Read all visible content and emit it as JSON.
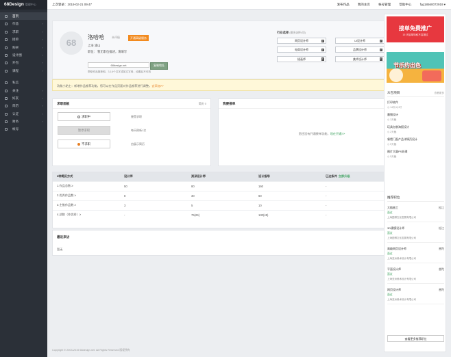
{
  "app": {
    "logo": "68Design",
    "logo_sub": "管理中心"
  },
  "sidebar": {
    "items": [
      {
        "label": "首页"
      },
      {
        "label": "作品"
      },
      {
        "label": "求职"
      },
      {
        "label": "接单"
      },
      {
        "label": "购买"
      },
      {
        "label": "设计圈"
      },
      {
        "label": "外包"
      },
      {
        "label": "课程"
      },
      {
        "label": "私信"
      },
      {
        "label": "关注"
      },
      {
        "label": "好友"
      },
      {
        "label": "简历"
      },
      {
        "label": "认证"
      },
      {
        "label": "财务"
      },
      {
        "label": "帐号"
      }
    ]
  },
  "topbar": {
    "last_login": "上次登录：2019-02-21 09:47",
    "links": [
      "发布作品",
      "我的主页",
      "帐号管理",
      "帮助中心",
      "fqq18560072919 ▾"
    ]
  },
  "profile": {
    "avatar_text": "68",
    "name": "洛哈哈",
    "badge_gray": "未评级",
    "badge_orange": "开通高级服务",
    "location": "上海 浦山",
    "desc": "职位：  暂无职位描述，请填写",
    "url": "68design.net",
    "url_btn": "复制地址",
    "note": "帮助作品推荐和，3-16个汉字或英文字母，设置后不可改"
  },
  "industry": {
    "title": "行业选择",
    "hint": "(最多选择4项)",
    "options": [
      {
        "label": "网页设计师",
        "checked": true
      },
      {
        "label": "UI设计师",
        "checked": true
      },
      {
        "label": "电商设计师",
        "checked": true
      },
      {
        "label": "品牌设计师",
        "checked": true
      },
      {
        "label": "插画师",
        "checked": true
      },
      {
        "label": "美术设计师",
        "checked": true
      }
    ]
  },
  "tip": {
    "text": "功能小贴士：新增作品推荐功能，您可以在作品页面对作品推荐进行调整。",
    "link": "去添加>>"
  },
  "job_panel": {
    "title": "求职面板",
    "right": "简历 0",
    "statuses": [
      {
        "label": "求职中",
        "desc": "接受求职"
      },
      {
        "label": "暂停求职",
        "desc": "每天刷新1次"
      },
      {
        "label": "不求职",
        "desc": "由展示简历"
      }
    ]
  },
  "recv": {
    "title": "我要接单",
    "right": "接单推广",
    "empty": "您还没有开通接单功能，",
    "empty_link": "现在开通>>"
  },
  "table": {
    "headers": [
      "4种简历方式",
      "设计师",
      "资深设计师",
      "设计指导",
      "已达条件",
      "立即升级"
    ],
    "rows": [
      [
        "1.作品总数 ≥",
        "50",
        "80",
        "160",
        "-"
      ],
      [
        "2.优秀作品数 ≥",
        "8",
        "30",
        "60",
        "-"
      ],
      [
        "3.主推作品数 ≥",
        "3",
        "5",
        "10",
        "-"
      ],
      [
        "4.总数（作优秀）≥",
        "-",
        "75(26)",
        "130(45)",
        "-"
      ]
    ]
  },
  "recent": {
    "title": "最近来访",
    "value": "暂无"
  },
  "footer": "Copyright © 2003-2019 68design.net. All Rights Reserved 版权所有",
  "right": {
    "promo_title": "接单免费推广",
    "promo_sub": "15 天接单特权不容错过",
    "promo2_text": "节乐约出色",
    "tasks_title": "众包项目",
    "tasks_more": "查看更多",
    "tasks": [
      {
        "title": "打印软件",
        "meta": "14天4小时"
      },
      {
        "title": "墨镜设计",
        "meta": "3天截"
      },
      {
        "title": "玩具包装海报设计",
        "meta": "2天截"
      },
      {
        "title": "餐馆门面产品详情页设计",
        "meta": "5天截"
      },
      {
        "title": "图片大量PS处理",
        "meta": "5天截"
      }
    ],
    "jobs_title": "推荐职位",
    "jobs": [
      {
        "title": "大插画工",
        "loc": "松江",
        "sal": "面议",
        "co": "上海图博文化发展有限公司"
      },
      {
        "title": "3D建模设计师",
        "loc": "松江",
        "sal": "面议",
        "co": "上海图博文化发展有限公司"
      },
      {
        "title": "高级网页设计师",
        "loc": "普陀",
        "sal": "面议",
        "co": "上海亚洲美术设计有限公司"
      },
      {
        "title": "平面设计师",
        "loc": "普陀",
        "sal": "面议",
        "co": "上海亚洲美术设计有限公司"
      },
      {
        "title": "网页设计师",
        "loc": "普陀",
        "sal": "面议",
        "co": "上海亚洲美术设计有限公司"
      }
    ],
    "more_jobs": "查看更多推荐职位"
  },
  "colors": {
    "sidebar": "#2b3038",
    "accent_orange": "#f28a1e",
    "accent_green": "#3aa05c",
    "promo_red": "#e7383f"
  }
}
